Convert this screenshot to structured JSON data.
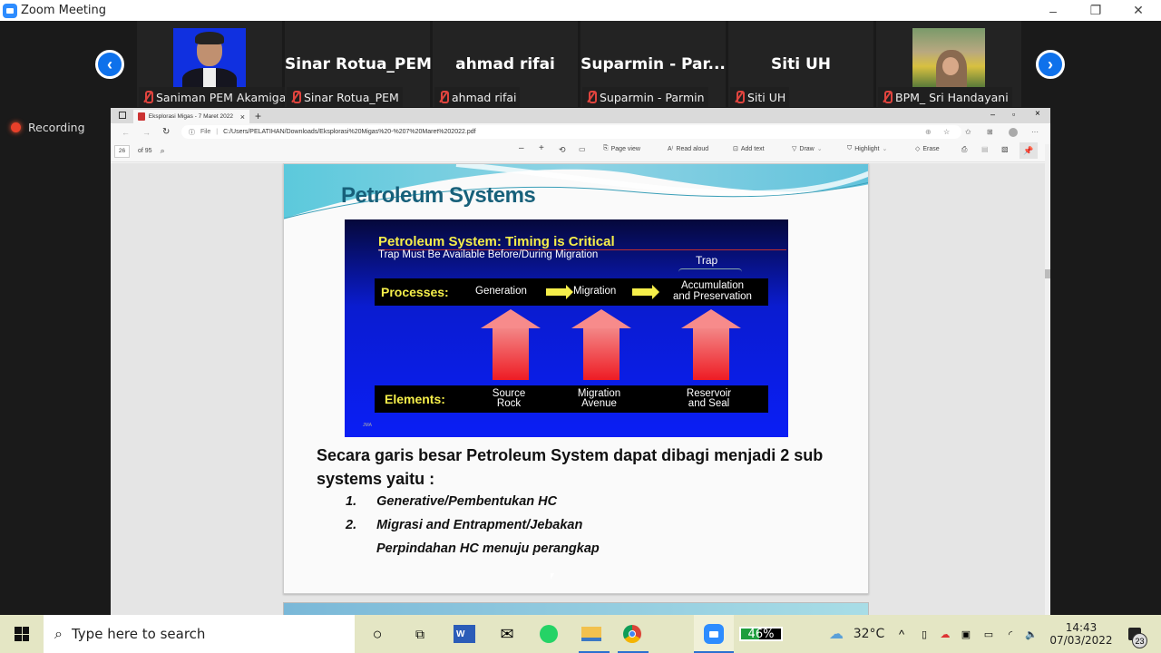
{
  "window": {
    "title": "Zoom Meeting",
    "controls": {
      "minimize": "–",
      "restore": "❐",
      "close": "✕"
    }
  },
  "meeting": {
    "prev_page_icon": "‹",
    "next_page_icon": "›",
    "recording_label": "Recording",
    "participants": [
      {
        "display": "",
        "label": "Saniman PEM Akamigas",
        "muted": true,
        "has_photo": true
      },
      {
        "display": "Sinar Rotua_PEM",
        "label": "Sinar Rotua_PEM",
        "muted": true,
        "has_photo": false
      },
      {
        "display": "ahmad rifai",
        "label": "ahmad rifai",
        "muted": true,
        "has_photo": false
      },
      {
        "display": "Suparmin  -  Par...",
        "label": "Suparmin - Parmin",
        "muted": true,
        "has_photo": false
      },
      {
        "display": "Siti UH",
        "label": "Siti UH",
        "muted": true,
        "has_photo": false
      },
      {
        "display": "",
        "label": "BPM_ Sri Handayani",
        "muted": true,
        "has_photo": true
      }
    ]
  },
  "browser": {
    "tab_title": "Eksplorasi Migas - 7 Maret 2022",
    "tab_close": "×",
    "new_tab": "+",
    "url_prefix": "File",
    "url": "C:/Users/PELATIHAN/Downloads/Eksplorasi%20Migas%20-%207%20Maret%202022.pdf",
    "win_controls": {
      "minimize": "–",
      "restore": "▫",
      "close": "×"
    },
    "pdf_toolbar": {
      "page_number": "26",
      "page_total": "of 95",
      "zoom_out": "–",
      "zoom_in": "+",
      "page_view": "Page view",
      "read_aloud": "Read aloud",
      "add_text": "Add text",
      "draw": "Draw",
      "highlight": "Highlight",
      "erase": "Erase"
    }
  },
  "slide": {
    "title": "Petroleum Systems",
    "diagram": {
      "title": "Petroleum System: Timing is Critical",
      "subtitle": "Trap Must Be Available Before/During Migration",
      "trap_label": "Trap",
      "processes_label": "Processes:",
      "processes": [
        "Generation",
        "Migration",
        "Accumulation",
        "and Preservation"
      ],
      "elements_label": "Elements:",
      "elements": [
        {
          "line1": "Source",
          "line2": "Rock"
        },
        {
          "line1": "Migration",
          "line2": "Avenue"
        },
        {
          "line1": "Reservoir",
          "line2": "and Seal"
        }
      ],
      "credit": "JMA"
    },
    "body_line1": "Secara garis besar Petroleum System dapat dibagi menjadi 2 sub",
    "body_line2": "systems yaitu :",
    "list": [
      {
        "num": "1.",
        "text": "Generative/Pembentukan HC"
      },
      {
        "num": "2.",
        "text": "Migrasi and Entrapment/Jebakan"
      }
    ],
    "list_note": "Perpindahan HC menuju perangkap"
  },
  "taskbar": {
    "search_placeholder": "Type here to search",
    "battery_percent": "46%",
    "temperature": "32°C",
    "time": "14:43",
    "date": "07/03/2022",
    "notifications": "23",
    "word_letter": "W"
  }
}
